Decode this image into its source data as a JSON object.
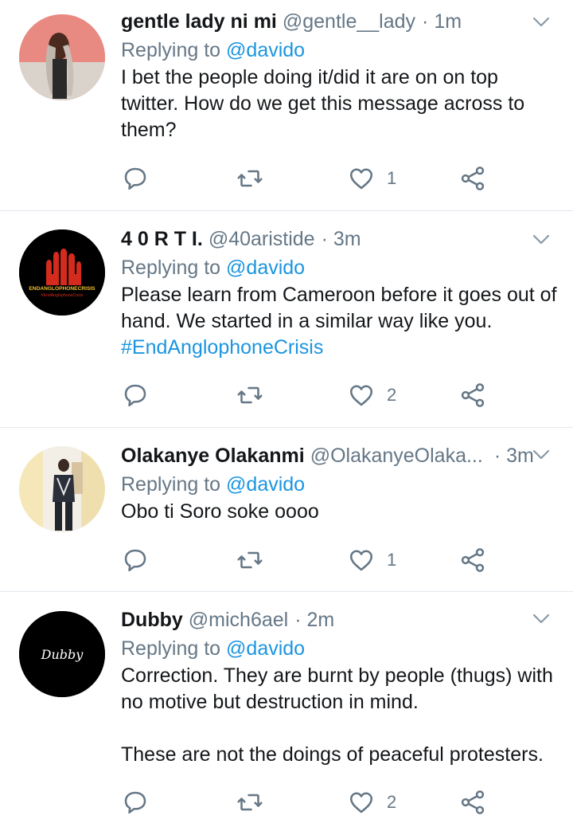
{
  "tweets": [
    {
      "name": "gentle lady ni mi",
      "handle": "@gentle__lady",
      "time": "· 1m",
      "replying_prefix": "Replying to",
      "replying_to": "@davido",
      "text_lines": [
        "I bet the people doing it/did it are on on top",
        "twitter. How do we get this message across to",
        "them?"
      ],
      "hashtag": "",
      "likes": "1",
      "avatar_icon": "woman-braids-avatar"
    },
    {
      "name": "4 0 R T I.",
      "handle": "@40aristide",
      "time": "· 3m",
      "replying_prefix": "Replying to",
      "replying_to": "@davido",
      "text_lines": [
        "Please learn from Cameroon before it goes out of",
        "hand. We started in a similar way like you."
      ],
      "hashtag": "#EndAnglophoneCrisis",
      "likes": "2",
      "avatar_icon": "raised-hands-logo-avatar",
      "avatar_text": "ENDANGLOPHONECRISIS",
      "avatar_subtext": "#EndAnglophoneCrisis"
    },
    {
      "name": "Olakanye Olakanmi",
      "handle": "@OlakanyeOlaka...",
      "time": "· 3m",
      "replying_prefix": "Replying to",
      "replying_to": "@davido",
      "text_lines": [
        "Obo ti Soro soke oooo"
      ],
      "hashtag": "",
      "likes": "1",
      "avatar_icon": "man-standing-avatar"
    },
    {
      "name": "Dubby",
      "handle": "@mich6ael",
      "time": "· 2m",
      "replying_prefix": "Replying to",
      "replying_to": "@davido",
      "text_lines": [
        "Correction. They are burnt by people (thugs) with",
        "no motive but destruction in mind.",
        "",
        "These are not the doings of peaceful protesters."
      ],
      "hashtag": "",
      "likes": "2",
      "avatar_icon": "signature-avatar",
      "avatar_text": "Dubby"
    }
  ],
  "colors": {
    "text": "#14171a",
    "muted": "#657786",
    "link": "#1b95e0",
    "divider": "#e1e8ed"
  },
  "icons": [
    "reply-icon",
    "retweet-icon",
    "like-icon",
    "share-icon",
    "chevron-down-icon"
  ]
}
